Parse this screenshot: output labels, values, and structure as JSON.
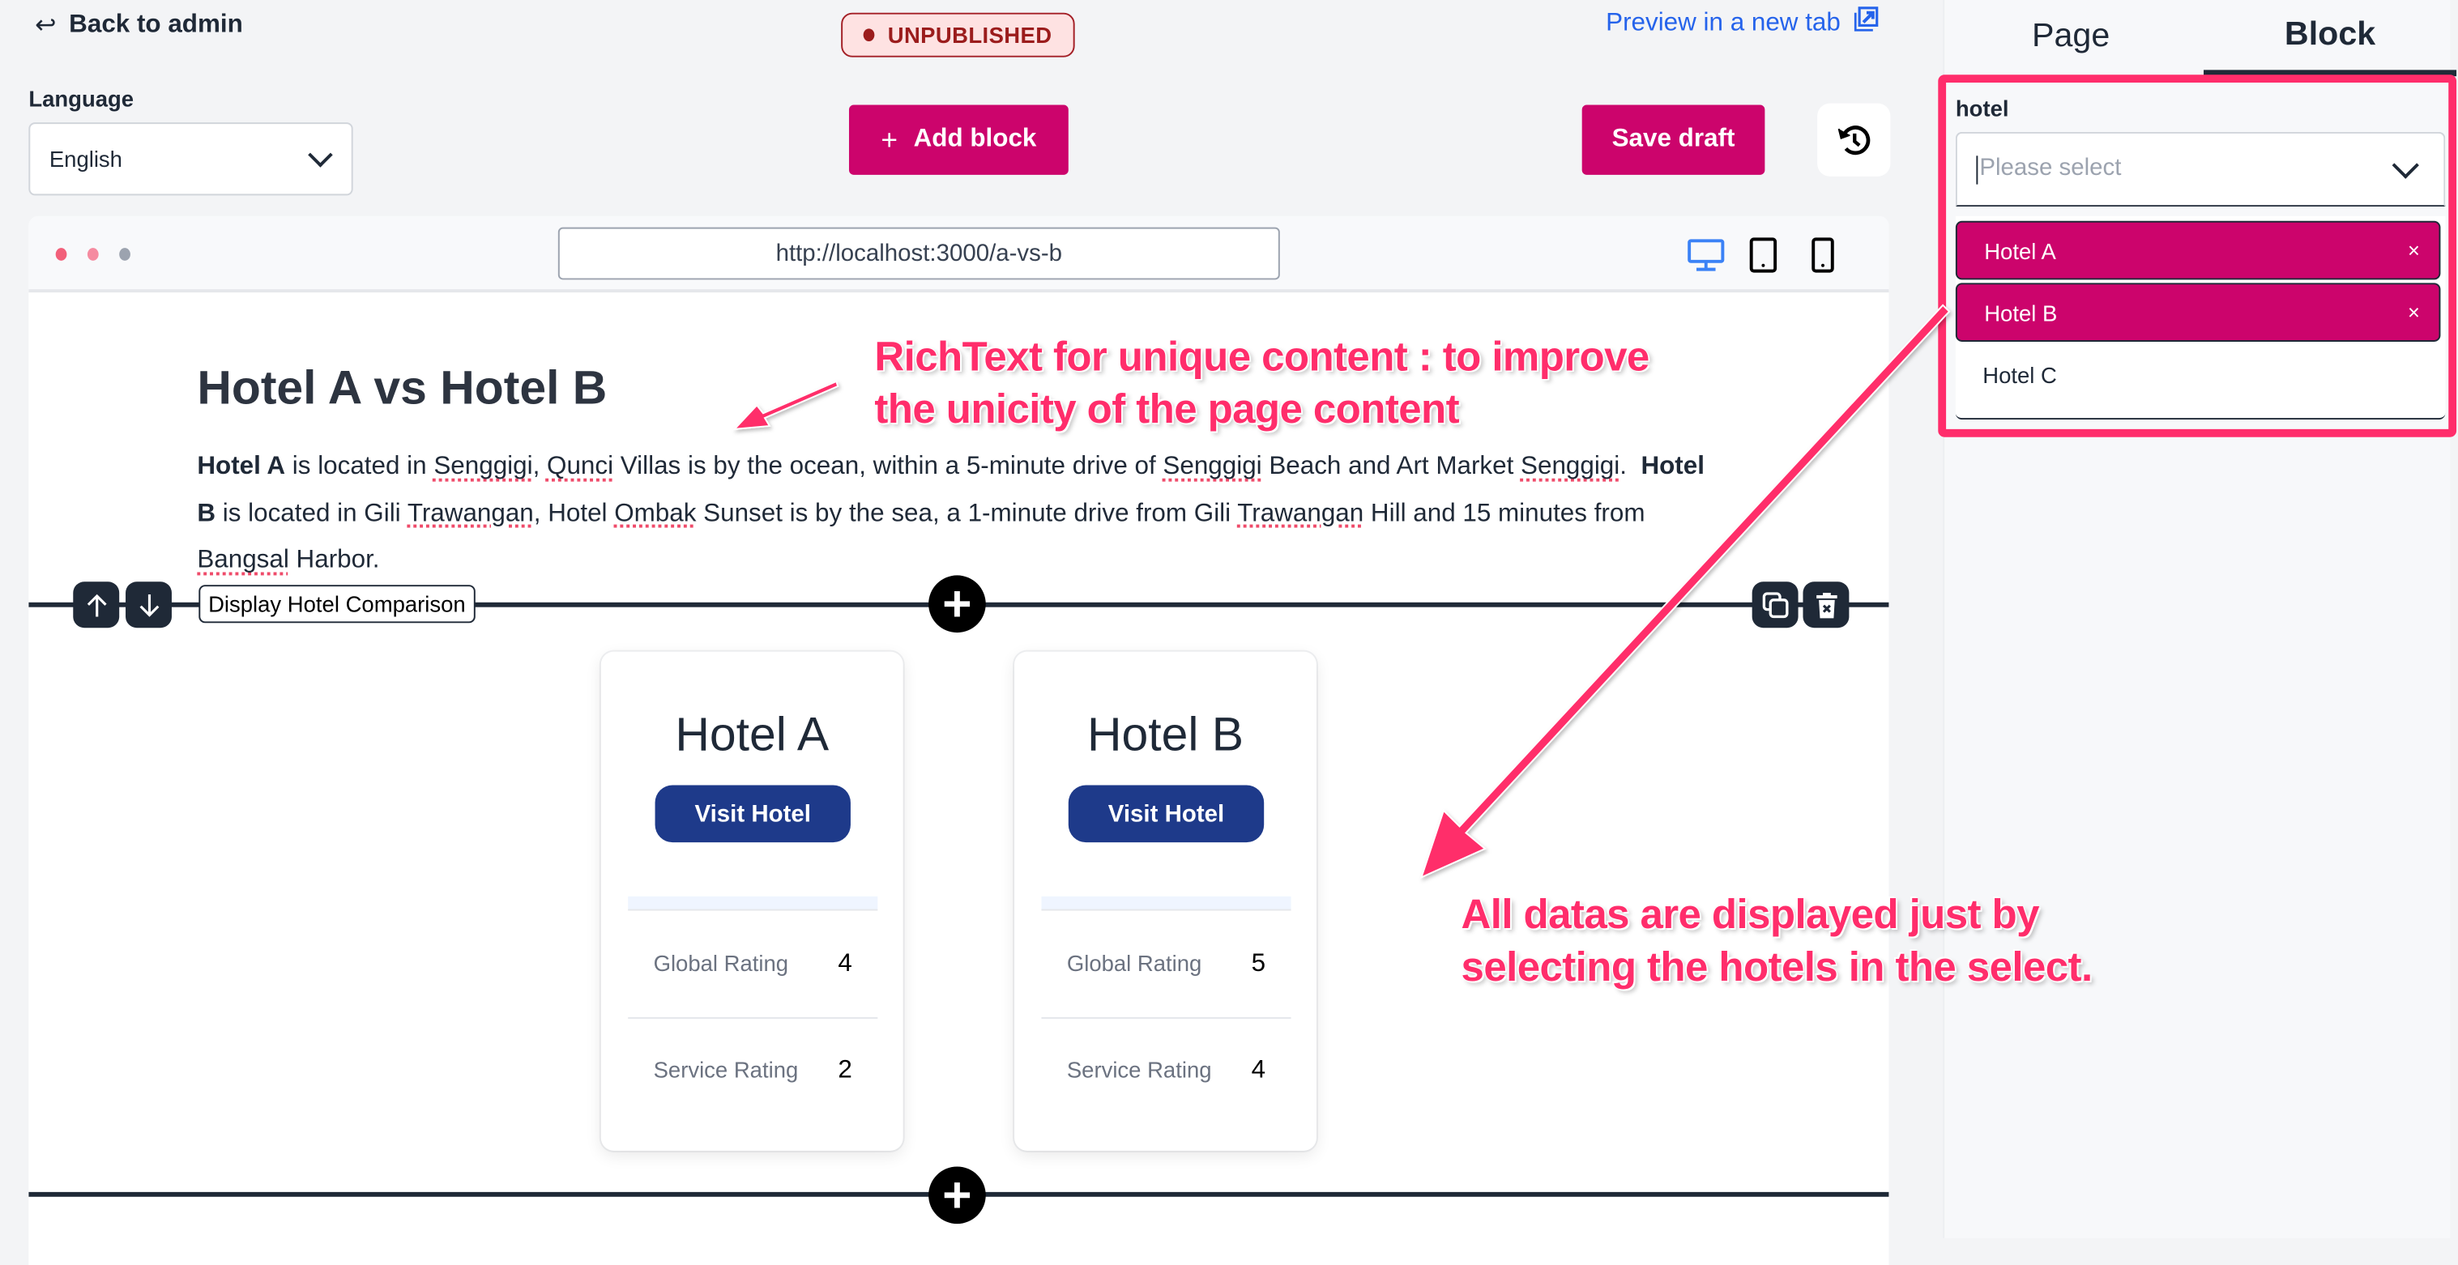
{
  "header": {
    "back_label": "Back to admin",
    "status_badge": "UNPUBLISHED",
    "preview_label": "Preview in a new tab",
    "language_label": "Language",
    "language_value": "English",
    "add_block_label": "Add block",
    "save_draft_label": "Save draft"
  },
  "colors": {
    "primary": "#cc046c",
    "link": "#2563eb",
    "badge_text": "#9b1c1c",
    "badge_bg": "#fee2e2",
    "visit_button": "#1e3a8a",
    "annotation": "#ff2d6b"
  },
  "preview_frame": {
    "url": "http://localhost:3000/a-vs-b",
    "devices": [
      "desktop-icon",
      "tablet-icon",
      "mobile-icon"
    ],
    "active_device": "desktop"
  },
  "content": {
    "heading": "Hotel A vs Hotel B",
    "paragraph": {
      "s1_bold": "Hotel A",
      "s1": " is located in ",
      "w1": "Senggigi",
      "s2": ", ",
      "w2": "Qunci",
      "s3": " Villas is by the ocean, within a 5-minute drive of ",
      "w3": "Senggigi",
      "s4": " Beach and Art Market ",
      "w4": "Senggigi",
      "s5": ".  ",
      "s6_bold": "Hotel B",
      "s6": " is located in Gili ",
      "w5": "Trawangan",
      "s7": ", Hotel ",
      "w6": "Ombak",
      "s8": " Sunset is by the sea, a 1-minute drive from Gili ",
      "w7": "Trawangan",
      "s9": " Hill and 15 minutes from ",
      "w8": "Bangsal",
      "s10": " Harbor."
    },
    "block_label": "Display Hotel Comparison",
    "hotels": [
      {
        "name": "Hotel A",
        "visit_label": "Visit Hotel",
        "ratings": [
          {
            "label": "Global Rating",
            "value": "4"
          },
          {
            "label": "Service Rating",
            "value": "2"
          }
        ]
      },
      {
        "name": "Hotel B",
        "visit_label": "Visit Hotel",
        "ratings": [
          {
            "label": "Global Rating",
            "value": "5"
          },
          {
            "label": "Service Rating",
            "value": "4"
          }
        ]
      }
    ]
  },
  "annotations": {
    "richtext_line1": "RichText for unique content : to improve",
    "richtext_line2": "the unicity of the page content",
    "select_line1": "All datas are displayed just by",
    "select_line2": "selecting the hotels in the select."
  },
  "panel": {
    "tabs": [
      {
        "label": "Page",
        "active": false
      },
      {
        "label": "Block",
        "active": true
      }
    ],
    "field_label": "hotel",
    "placeholder": "Please select",
    "options": [
      {
        "label": "Hotel A",
        "selected": true,
        "remove": "×"
      },
      {
        "label": "Hotel B",
        "selected": true,
        "remove": "×"
      },
      {
        "label": "Hotel C",
        "selected": false
      }
    ]
  }
}
